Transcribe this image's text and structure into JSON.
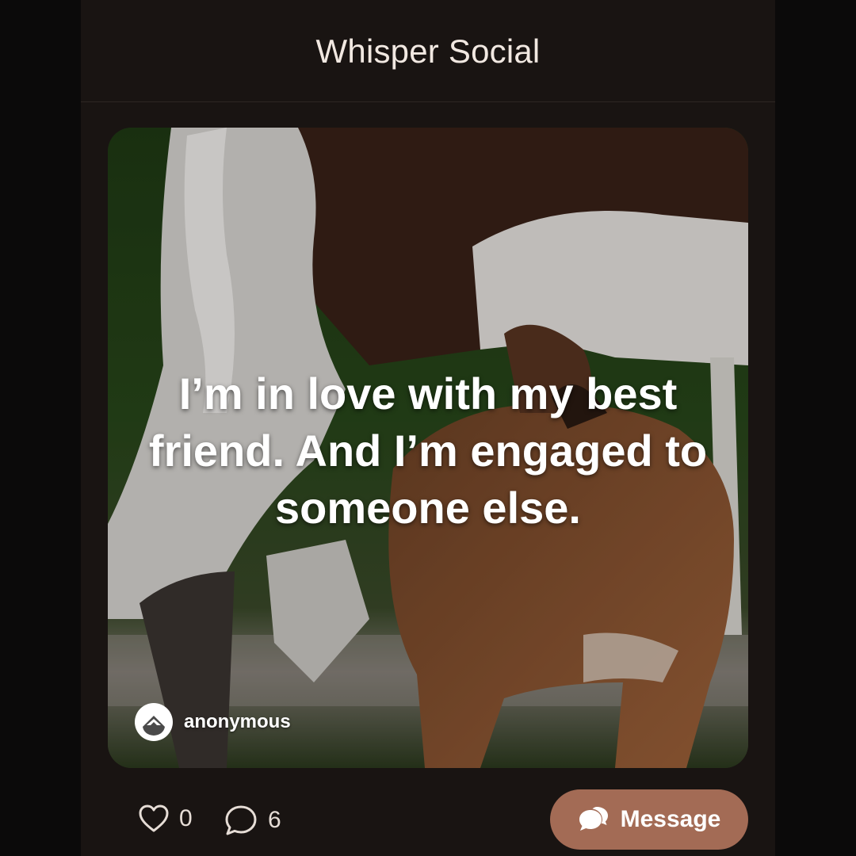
{
  "app": {
    "title": "Whisper Social"
  },
  "post": {
    "text": "I’m in love with my best friend. And I’m engaged to someone else.",
    "author": "anonymous",
    "background": "gazelle-nursing-fawn-photo"
  },
  "stats": {
    "likes": "0",
    "comments": "6"
  },
  "actions": {
    "message_label": "Message"
  },
  "colors": {
    "background": "#191412",
    "accent": "#a36b55",
    "title": "#f1e8e1"
  },
  "icons": {
    "like": "heart-icon",
    "comment": "comment-bubble-icon",
    "message": "chat-bubbles-icon",
    "avatar": "mask-avatar-icon"
  }
}
